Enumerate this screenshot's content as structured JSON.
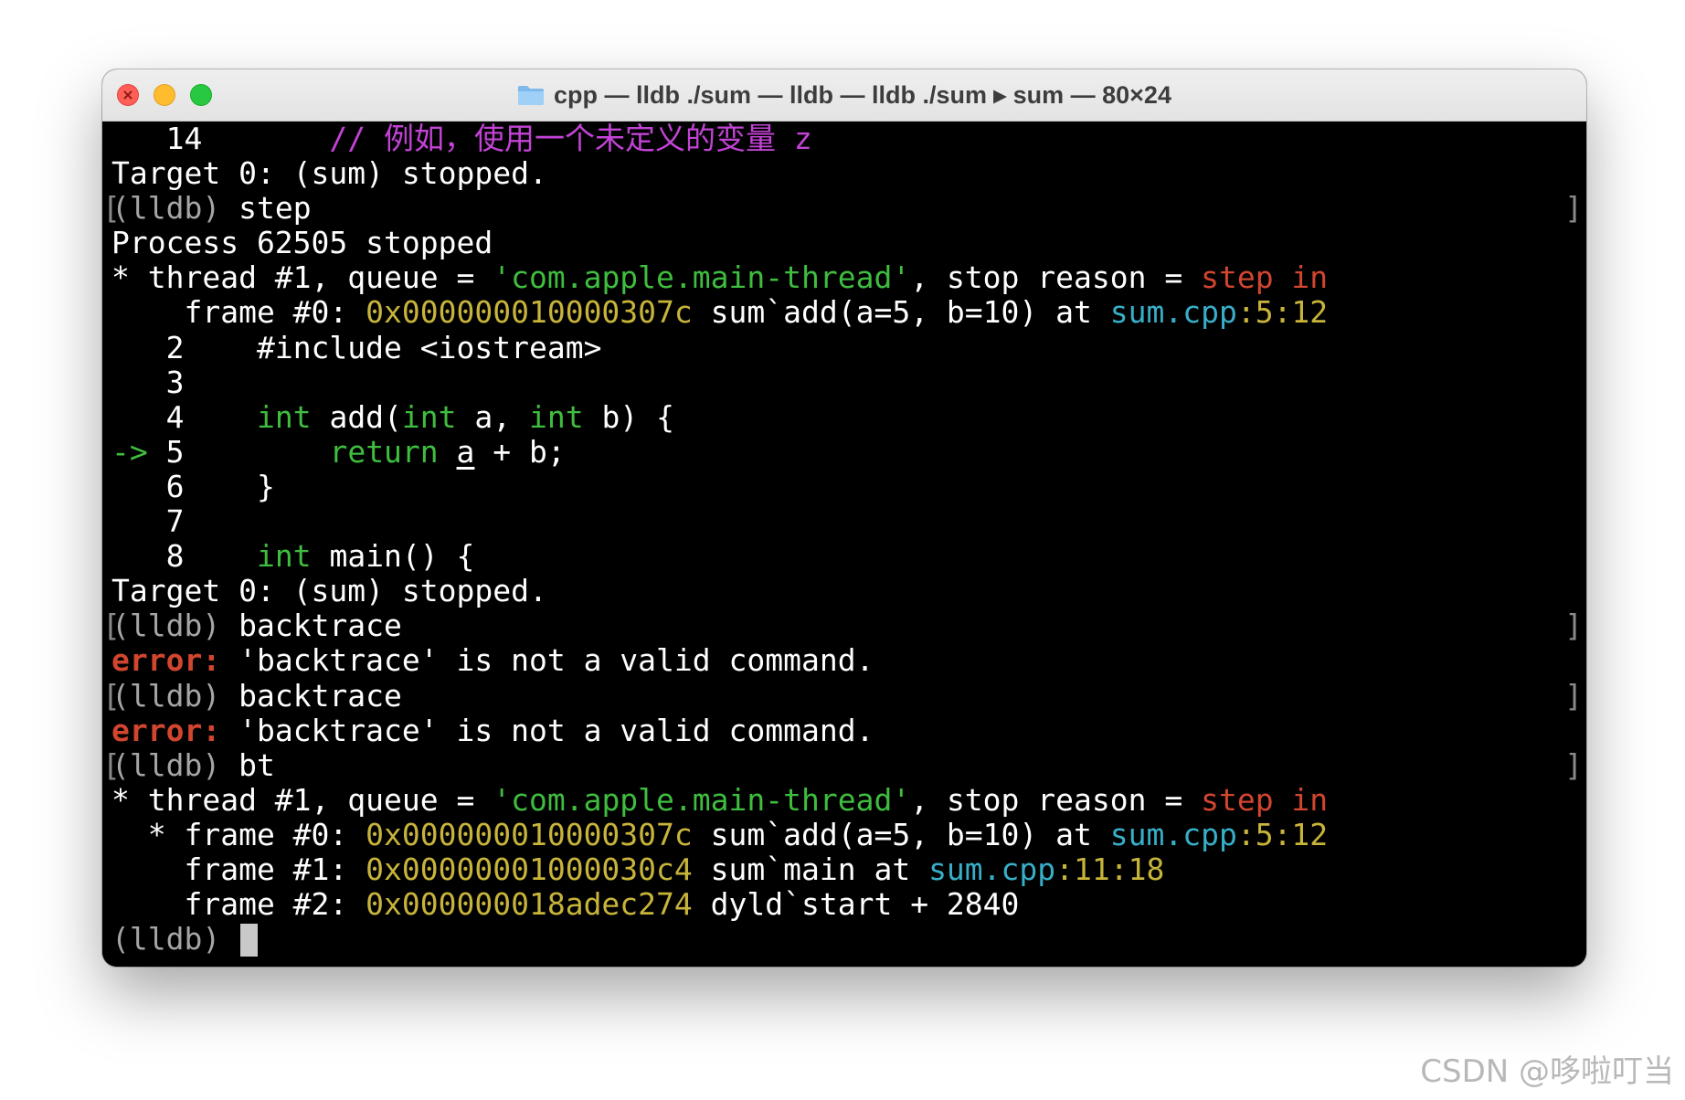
{
  "window": {
    "title": "cpp — lldb ./sum — lldb — lldb ./sum ▸ sum — 80×24",
    "title_icon": "folder-icon"
  },
  "colors": {
    "background": "#000000",
    "text": "#ffffff",
    "green": "#3fbd3f",
    "yellow": "#c8b43a",
    "cyan": "#37afc8",
    "red": "#d2452f",
    "magenta": "#c343d6",
    "prompt_gray": "#a5a5a5"
  },
  "terminal": {
    "prompt": "(lldb)",
    "lines": {
      "l0_num": "   14",
      "l0_comment": "// 例如，使用一个未定义的变量 z",
      "target_stopped": "Target 0: (sum) stopped.",
      "cmd_step": "step",
      "process_stopped": "Process 62505 stopped",
      "thread_prefix": "* thread #1, queue = ",
      "thread_queue": "'com.apple.main-thread'",
      "thread_mid": ", stop reason = ",
      "thread_reason": "step in",
      "frame0_prefix": "    frame #0: ",
      "frame0_prefix_star": "  * frame #0: ",
      "frame0_addr": "0x000000010000307c",
      "frame0_func": " sum`add(a=5, b=10) at ",
      "file": "sum.cpp",
      "frame0_loc": ":5:12",
      "src2_num": "   2",
      "src2_code": "    #include <iostream>",
      "src3_num": "   3",
      "src4_num": "   4",
      "src4_int1": "int",
      "src4_a": " add(",
      "src4_int2": "int",
      "src4_b": " a, ",
      "src4_int3": "int",
      "src4_c": " b) {",
      "src5_arrow": "->",
      "src5_num": " 5",
      "src5_ret": "return",
      "src5_a": "a",
      "src5_rest": " + b;",
      "src6_num": "   6",
      "src6_code": "    }",
      "src7_num": "   7",
      "src8_num": "   8",
      "src8_int": "int",
      "src8_rest": " main() {",
      "cmd_backtrace": "backtrace",
      "error_label": "error:",
      "error_msg": " 'backtrace' is not a valid command.",
      "cmd_bt": "bt",
      "frame1_prefix": "    frame #1: ",
      "frame1_addr": "0x00000001000030c4",
      "frame1_func": " sum`main at ",
      "frame1_loc": ":11:18",
      "frame2_prefix": "    frame #2: ",
      "frame2_addr": "0x000000018adec274",
      "frame2_func": " dyld`start + 2840"
    }
  },
  "watermark": "CSDN @哆啦叮当"
}
